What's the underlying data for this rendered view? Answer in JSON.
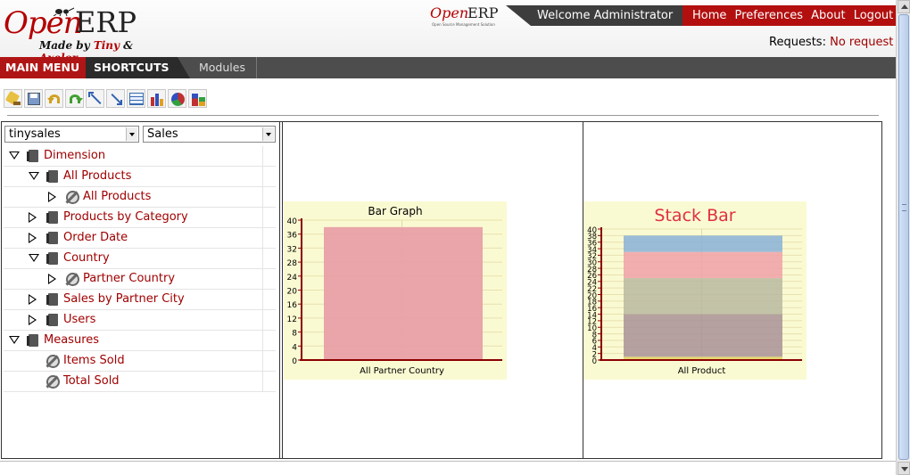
{
  "header": {
    "logo_open": "Open",
    "logo_erp": "ERP",
    "logo_tag_prefix": "Made by ",
    "logo_tag_tiny": "Tiny",
    "logo_tag_and": " & ",
    "logo_tag_axelor": "Axelor",
    "small_logo_open": "Open",
    "small_logo_erp": "ERP",
    "small_logo_sub": "Open Source Management Solution",
    "welcome": "Welcome Administrator",
    "top_links": [
      "Home",
      "Preferences",
      "About",
      "Logout"
    ],
    "requests_label": "Requests:",
    "requests_value": "No request"
  },
  "menubar": {
    "main_menu": "MAIN MENU",
    "shortcuts": "SHORTCUTS",
    "modules": "Modules"
  },
  "toolbar": {
    "icons": [
      "clear-icon",
      "save-icon",
      "undo-icon",
      "redo-icon",
      "expand-icon",
      "collapse-icon",
      "table-view-icon",
      "bar-chart-icon",
      "pie-chart-icon",
      "stacked-chart-icon"
    ]
  },
  "filters": {
    "cube": "tinysales",
    "view": "Sales"
  },
  "tree": [
    {
      "label": "Dimension",
      "level": 0,
      "toggle": "down",
      "icon": "folder-icon"
    },
    {
      "label": "All Products",
      "level": 1,
      "toggle": "down",
      "icon": "folder-icon"
    },
    {
      "label": "All Products",
      "level": 2,
      "toggle": "right",
      "icon": "gear-icon"
    },
    {
      "label": "Products by Category",
      "level": 1,
      "toggle": "right",
      "icon": "folder-icon"
    },
    {
      "label": "Order Date",
      "level": 1,
      "toggle": "right",
      "icon": "folder-icon"
    },
    {
      "label": "Country",
      "level": 1,
      "toggle": "down",
      "icon": "folder-icon"
    },
    {
      "label": "Partner Country",
      "level": 2,
      "toggle": "right",
      "icon": "gear-icon"
    },
    {
      "label": "Sales by Partner City",
      "level": 1,
      "toggle": "right",
      "icon": "folder-icon"
    },
    {
      "label": "Users",
      "level": 1,
      "toggle": "right",
      "icon": "folder-icon"
    },
    {
      "label": "Measures",
      "level": 0,
      "toggle": "down",
      "icon": "folder-icon"
    },
    {
      "label": "Items Sold",
      "level": 1,
      "toggle": "none",
      "icon": "gear-icon"
    },
    {
      "label": "Total Sold",
      "level": 1,
      "toggle": "none",
      "icon": "gear-icon"
    }
  ],
  "chart_data": [
    {
      "type": "bar",
      "title": "Bar Graph",
      "categories": [
        "All Partner Country"
      ],
      "values": [
        38
      ],
      "ylim": [
        0,
        40
      ],
      "yticks": [
        0,
        4,
        8,
        12,
        16,
        20,
        24,
        28,
        32,
        36,
        40
      ],
      "grid": true,
      "color": "#e8a0a8",
      "background": "#fafad2",
      "title_color": "#000000"
    },
    {
      "type": "bar",
      "stacked": true,
      "title": "Stack Bar",
      "categories": [
        "All Product"
      ],
      "series": [
        {
          "values": [
            1
          ],
          "color": "#e0d060"
        },
        {
          "values": [
            13
          ],
          "color": "#a89098"
        },
        {
          "values": [
            11
          ],
          "color": "#b8b8a0"
        },
        {
          "values": [
            8
          ],
          "color": "#f0a0a8"
        },
        {
          "values": [
            5
          ],
          "color": "#88b0d8"
        }
      ],
      "ylim": [
        0,
        40
      ],
      "yticks": [
        0,
        2,
        4,
        6,
        8,
        10,
        12,
        14,
        16,
        18,
        20,
        22,
        24,
        26,
        28,
        30,
        32,
        34,
        36,
        38,
        40
      ],
      "grid": true,
      "background": "#fafad2",
      "title_color": "#e03040"
    }
  ]
}
